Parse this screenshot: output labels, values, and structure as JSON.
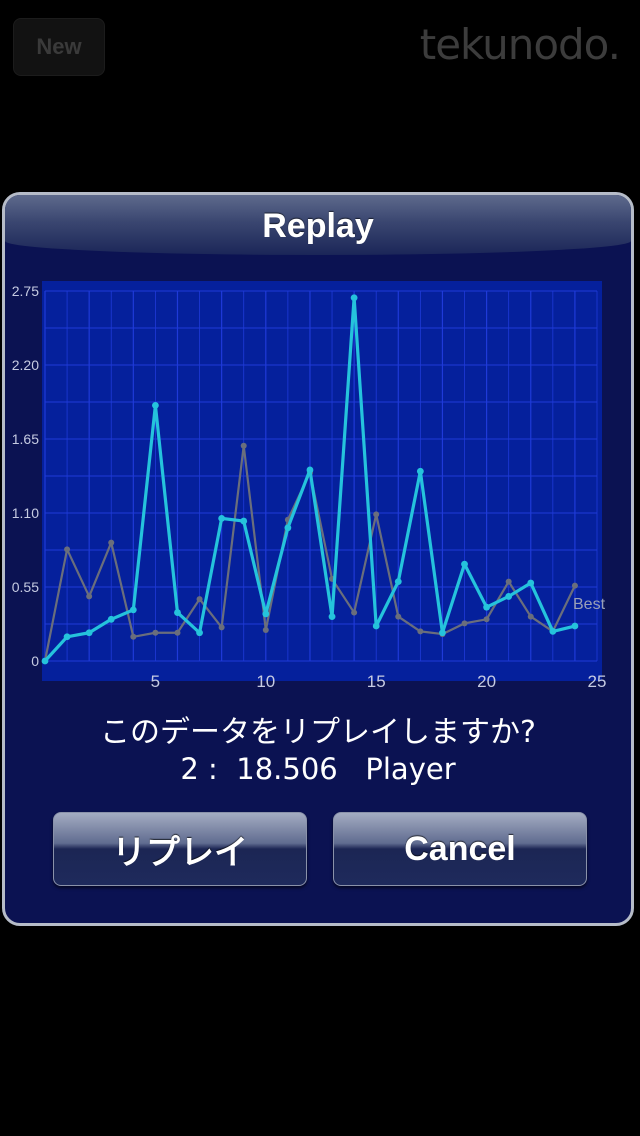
{
  "topbar": {
    "new_label": "New",
    "logo_text": "tekunodo."
  },
  "dialog": {
    "title": "Replay",
    "question": "このデータをリプレイしますか?",
    "record": "2 :  18.506   Player",
    "replay_button": "リプレイ",
    "cancel_button": "Cancel"
  },
  "colors": {
    "player_line": "#25c3dc",
    "best_line": "#6a6e7c",
    "plot_bg": "#05209c",
    "grid": "#1f3ad8",
    "dialog_bg": "#0b1252"
  },
  "chart_data": {
    "type": "line",
    "x": [
      0,
      1,
      2,
      3,
      4,
      5,
      6,
      7,
      8,
      9,
      10,
      11,
      12,
      13,
      14,
      15,
      16,
      17,
      18,
      19,
      20,
      21,
      22,
      23,
      24
    ],
    "x_ticks": [
      "5",
      "10",
      "15",
      "20",
      "25"
    ],
    "y_ticks": [
      "0",
      "0.55",
      "1.10",
      "1.65",
      "2.20",
      "2.75"
    ],
    "xlim": [
      0,
      25
    ],
    "ylim": [
      0,
      2.75
    ],
    "grid": true,
    "series": [
      {
        "role": "player",
        "values": [
          0,
          0.18,
          0.21,
          0.31,
          0.38,
          1.9,
          0.36,
          0.21,
          1.06,
          1.04,
          0.35,
          0.99,
          1.42,
          0.33,
          2.7,
          0.26,
          0.59,
          1.41,
          0.21,
          0.72,
          0.4,
          0.48,
          0.58,
          0.22,
          0.26
        ]
      },
      {
        "role": "best",
        "name": "Best",
        "values": [
          0,
          0.83,
          0.48,
          0.88,
          0.18,
          0.21,
          0.21,
          0.46,
          0.25,
          1.6,
          0.23,
          1.05,
          1.4,
          0.61,
          0.36,
          1.09,
          0.33,
          0.22,
          0.2,
          0.28,
          0.31,
          0.59,
          0.33,
          0.22,
          0.56
        ]
      }
    ]
  }
}
